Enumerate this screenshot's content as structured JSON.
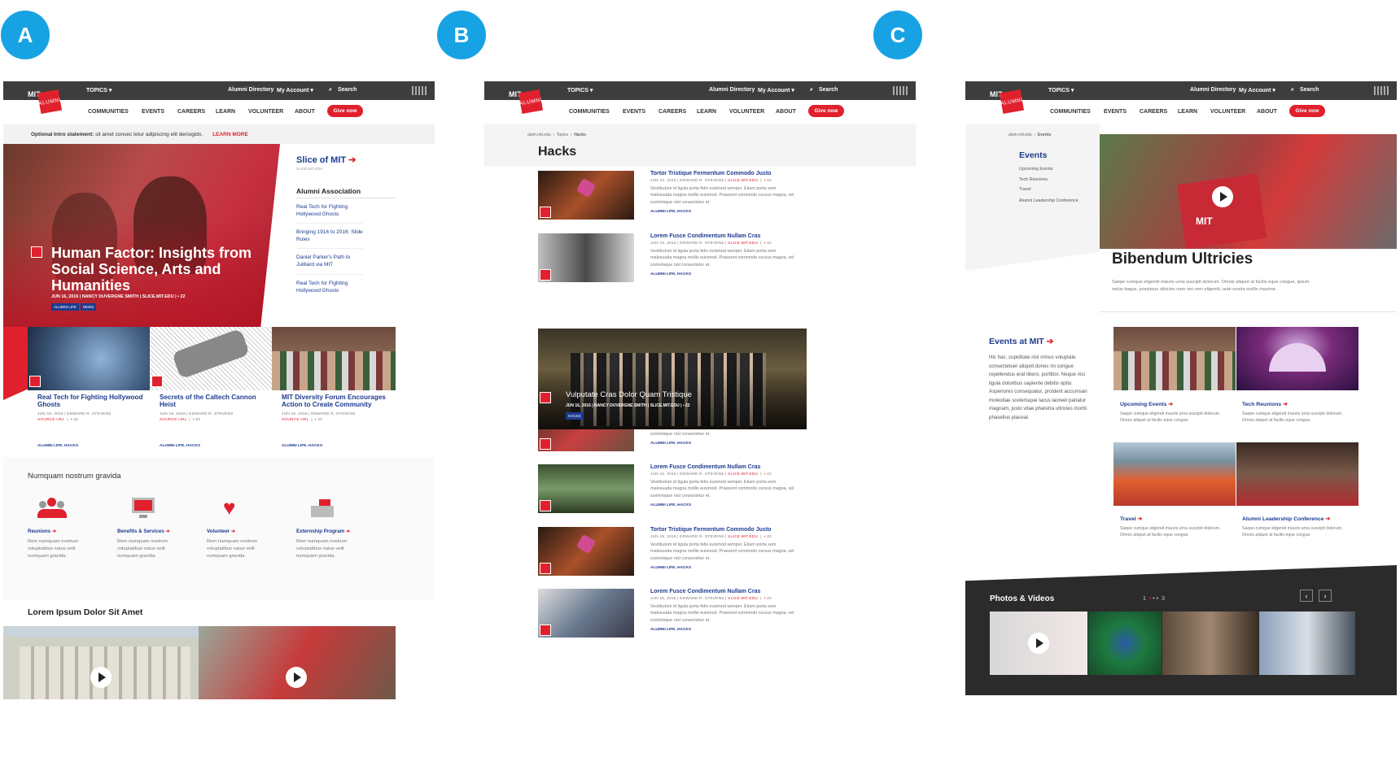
{
  "labels": [
    "A",
    "B",
    "C"
  ],
  "header": {
    "topics": "TOPICS ▾",
    "alumni_dir": "Alumni Directory",
    "account": "My Account ▾",
    "search": "Search",
    "logo_mit": "MIT",
    "logo_alumni": "ALUMNI",
    "give": "Give now",
    "nav": [
      "COMMUNITIES",
      "EVENTS",
      "CAREERS",
      "LEARN",
      "VOLUNTEER",
      "ABOUT"
    ]
  },
  "a": {
    "intro_bold": "Optional Intro statement:",
    "intro_text": "sit amet consec tetur adipiscing elit derisigido.",
    "learn_more": "LEARN MORE",
    "hero_title": "Human Factor: Insights from Social Science, Arts and Humanities",
    "hero_meta": "JUN 16, 2016  |  NANCY DUVERGNE SMITH  |  SLICE.MIT.EDU  |  ▪ 22",
    "hero_tags": [
      "ALUMNI LIFE",
      "NEWS"
    ],
    "slice_title": "Slice of MIT",
    "slice_sub": "SLICE.MIT.EDU",
    "assoc_title": "Alumni Association",
    "assoc_links": [
      "Real Tech for Fighting Hollywood Ghosts",
      "Bringing 1916 to 2016: Slide Rules",
      "Daniel Parker's Path to Juilliard via MIT",
      "Real Tech for Fighting Hollywood Ghosts"
    ],
    "cards": [
      {
        "title": "Real Tech for Fighting Hollywood Ghosts",
        "meta": "JUN 15, 2016  |  EDWARD R. STEVENS",
        "src": "SOURCE URL",
        "count": "22",
        "tags": "ALUMNI LIFE,  HACKS"
      },
      {
        "title": "Secrets of the Caltech Cannon Heist",
        "meta": "JUN 15, 2016  |  EDWARD R. STEVENS",
        "src": "SOURCE URL",
        "count": "22",
        "tags": "ALUMNI LIFE,  HACKS"
      },
      {
        "title": "MIT Diversity Forum Encourages Action to Create Community",
        "meta": "JUN 15, 2016  |  EDWARD R. STEVENS",
        "src": "SOURCE URL",
        "count": "22",
        "tags": "ALUMNI LIFE,  HACKS"
      }
    ],
    "section_title": "Numquam nostrum gravida",
    "services": [
      {
        "label": "Reunions",
        "text": "Rem numquam nostrum voluptatibus natus velit numquam gravida.",
        "icon": "people-icon"
      },
      {
        "label": "Benefits & Services",
        "text": "Rem numquam nostrum voluptatibus natus velit numquam gravida.",
        "icon": "monitor-check-icon"
      },
      {
        "label": "Volunteer",
        "text": "Rem numquam nostrum voluptatibus natus velit numquam gravida.",
        "icon": "heart-hands-icon"
      },
      {
        "label": "Externship Program",
        "text": "Rem numquam nostrum voluptatibus natus velit numquam gravida.",
        "icon": "desk-icon"
      }
    ],
    "bottom_title": "Lorem Ipsum Dolor Sit Amet"
  },
  "b": {
    "crumbs": [
      "alum.mit.edu",
      "Topics",
      "Hacks"
    ],
    "page_title": "Hacks",
    "items": [
      {
        "title": "Tortor Tristique Fermentum Commodo Justo",
        "meta": "JUN 15, 2016  |  EDWARD R. STEVENS  |",
        "src": "SLICE.MIT.EDU",
        "count": "22",
        "text": "Vestibulum id ligula porta felis euismod semper. Etiam porta sem malesuada magna mollis euismod. Praesent commodo cursus magna, vel scelerisque nisl consectetur et.",
        "tags": "ALUMNI LIFE, HACKS"
      },
      {
        "title": "Lorem Fusce Condimentum Nullam Cras",
        "meta": "JUN 15, 2016  |  EDWARD R. STEVENS  |",
        "src": "SLICE.MIT.EDU",
        "count": "22",
        "text": "Vestibulum id ligula porta felis euismod semper. Etiam porta sem malesuada magna mollis euismod. Praesent commodo cursus magna, vel scelerisque nisl consectetur et.",
        "tags": "ALUMNI LIFE, HACKS"
      },
      {
        "title": "Tortor Tristique Fermentum Commodo Justo",
        "meta": "JUN 15, 2016  |  EDWARD R. STEVENS  |",
        "src": "SLICE.MIT.EDU",
        "count": "22",
        "text": "Vestibulum id ligula porta felis euismod semper. Etiam porta sem malesuada magna mollis euismod. Praesent commodo cursus magna, vel scelerisque nisl consectetur et.",
        "tags": "ALUMNI LIFE, HACKS"
      },
      {
        "title": "Lorem Fusce Condimentum Nullam Cras",
        "meta": "JUN 15, 2016  |  EDWARD R. STEVENS  |",
        "src": "SLICE.MIT.EDU",
        "count": "22",
        "text": "Vestibulum id ligula porta felis euismod semper. Etiam porta sem malesuada magna mollis euismod. Praesent commodo cursus magna, vel scelerisque nisl consectetur et.",
        "tags": "ALUMNI LIFE, HACKS"
      },
      {
        "title": "Tortor Tristique Fermentum Commodo Justo",
        "meta": "JUN 15, 2016  |  EDWARD R. STEVENS  |",
        "src": "SLICE.MIT.EDU",
        "count": "22",
        "text": "Vestibulum id ligula porta felis euismod semper. Etiam porta sem malesuada magna mollis euismod. Praesent commodo cursus magna, vel scelerisque nisl consectetur et.",
        "tags": "ALUMNI LIFE, HACKS"
      },
      {
        "title": "Lorem Fusce Condimentum Nullam Cras",
        "meta": "JUN 15, 2016  |  EDWARD R. STEVENS  |",
        "src": "SLICE.MIT.EDU",
        "count": "22",
        "text": "Vestibulum id ligula porta felis euismod semper. Etiam porta sem malesuada magna mollis euismod. Praesent commodo cursus magna, vel scelerisque nisl consectetur et.",
        "tags": "ALUMNI LIFE, HACKS"
      }
    ],
    "feature_title": "Vulputate Cras Dolor Quam Tristique",
    "feature_meta": "JUN 16, 2016  |  NANCY DUVERGNE SMITH  |  SLICE.MIT.EDU  |  ▪ 22",
    "feature_tag": "HACKS"
  },
  "c": {
    "crumbs": [
      "alum.mit.edu",
      "Events"
    ],
    "side_title": "Events",
    "side_links": [
      "Upcoming Events",
      "Tech Reunions",
      "Travel",
      "Alumni Leadership Conference"
    ],
    "hero_title": "Bibendum Ultricies",
    "hero_text": "Saepe cumque eligendi mauris urna suscipit dolorum. Omnis aliquet at facilis eque congue, ipsum netus itaque, possimus ultricies nam nec rem eligendi, aute nostra mollis maxime.",
    "events_title": "Events at MIT",
    "events_text": "Hic hac, cupiditate nisl minus voluptate consectetuer aliquid donec mi congue repellendus erat libero, porttitor. Neque nisi ligula doloribus sapiente debitis optio. Asperiores consequatur, proident accumsan molestiae scelerisque lacus laoreet pariatur magnam, justo vitae pharetra ultricies morbi phasellus placeat.",
    "tiles": [
      {
        "title": "Upcoming Events",
        "text": "Saepe cumque eligendi mauris urna suscipit dolorum. Omnis aliquet at facilis eque congue."
      },
      {
        "title": "Tech Reunions",
        "text": "Saepe cumque eligendi mauris urna suscipit dolorum. Omnis aliquet at facilis eque congue."
      },
      {
        "title": "Travel",
        "text": "Saepe cumque eligendi mauris urna suscipit dolorum. Omnis aliquet at facilis eque congue."
      },
      {
        "title": "Alumni Leadership Conference",
        "text": "Saepe cumque eligendi mauris urna suscipit dolorum. Omnis aliquet at facilis eque congue."
      }
    ],
    "photos_title": "Photos & Videos",
    "pager_first": "1",
    "pager_last": "3"
  }
}
